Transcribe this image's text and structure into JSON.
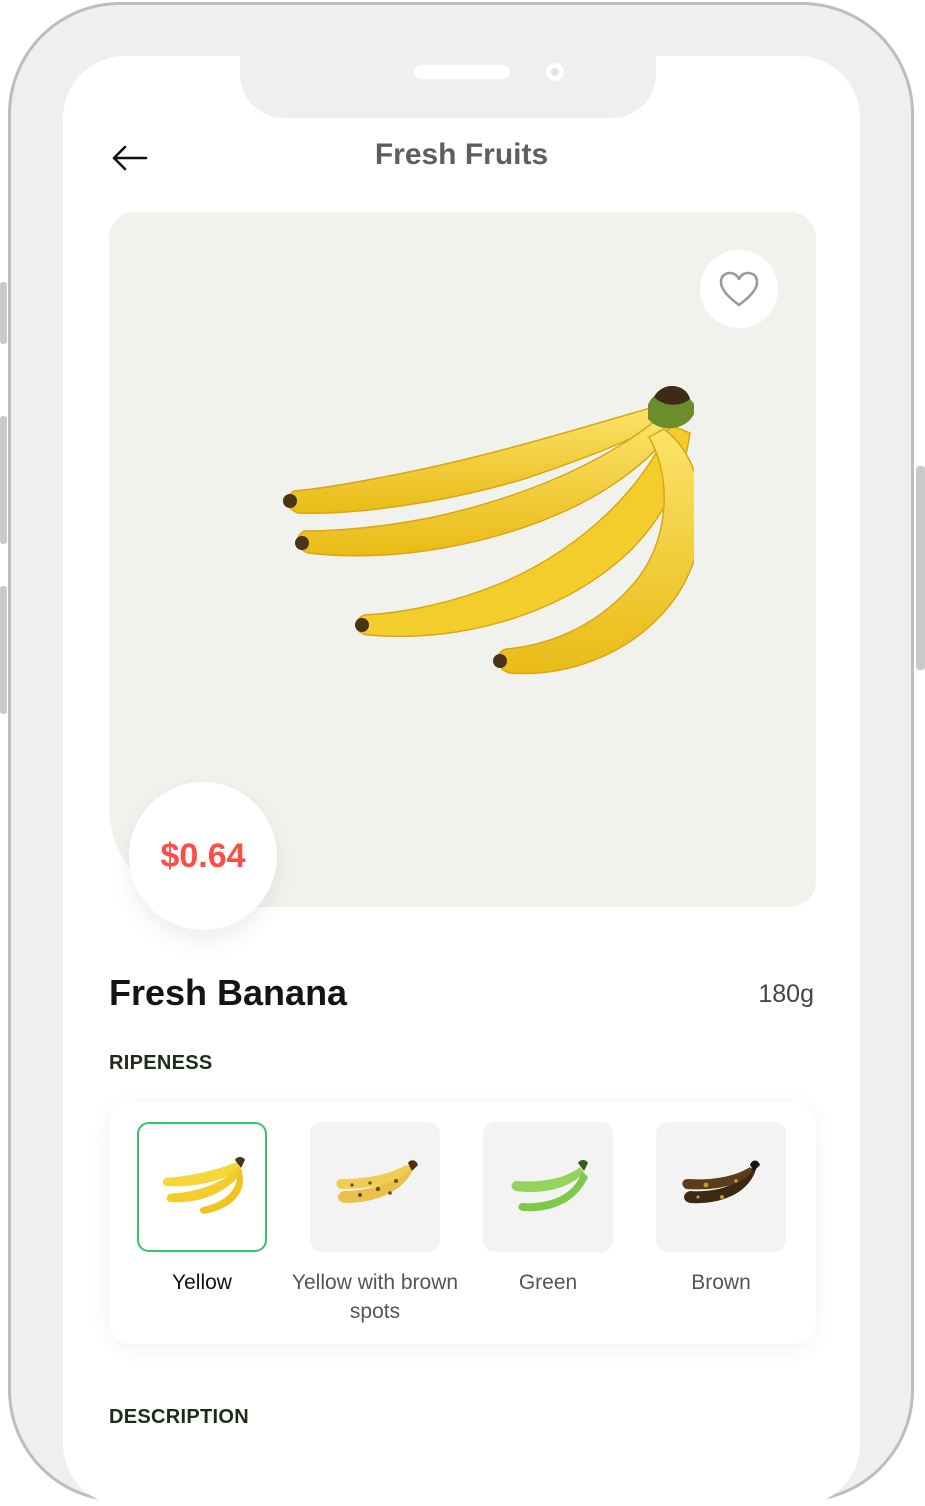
{
  "header": {
    "title": "Fresh Fruits"
  },
  "product": {
    "price": "$0.64",
    "name": "Fresh Banana",
    "weight": "180g"
  },
  "ripeness": {
    "label": "RIPENESS",
    "selected": "Yellow",
    "options": [
      {
        "label": "Yellow"
      },
      {
        "label": "Yellow with brown spots"
      },
      {
        "label": "Green"
      },
      {
        "label": "Brown"
      }
    ]
  },
  "description": {
    "label": "DESCRIPTION"
  },
  "colors": {
    "accent_green": "#36c36a",
    "price_red": "#ff4d45",
    "hero_bg": "#f1f2ed"
  }
}
